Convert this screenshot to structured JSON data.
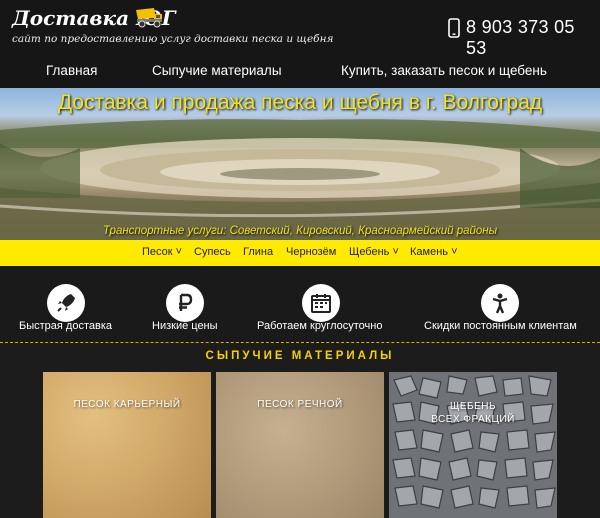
{
  "header": {
    "logo_title": "Доставка ЮГ",
    "logo_subtitle": "сайт по предоставлению услуг доставки песка и щебня",
    "phone": "8 903 373 05 53"
  },
  "nav": {
    "items": [
      "Главная",
      "Сыпучие материалы",
      "Купить, заказать песок и щебень"
    ]
  },
  "banner": {
    "title": "Доставка и продажа песка и щебня в г. Волгоград",
    "subtitle": "Транспортные услуги: Советский, Кировский, Красноармейский районы"
  },
  "categories": [
    "Песок",
    "Супесь",
    "Глина",
    "Чернозём",
    "Щебень",
    "Камень"
  ],
  "features": [
    {
      "label": "Быстрая доставка",
      "icon": "rocket-icon"
    },
    {
      "label": "Низкие цены",
      "icon": "ruble-icon"
    },
    {
      "label": "Работаем круглосуточно",
      "icon": "calendar-icon"
    },
    {
      "label": "Скидки постоянным клиентам",
      "icon": "person-icon"
    }
  ],
  "section": {
    "title": "СЫПУЧИЕ МАТЕРИАЛЫ"
  },
  "materials": [
    {
      "label": "ПЕСОК  КАРЬЕРНЫЙ",
      "color": "#d2aa6a"
    },
    {
      "label": "ПЕСОК  РЕЧНОЙ",
      "color": "#b39c7c"
    },
    {
      "label": "ЩЕБЕНЬ\nВСЕХ  ФРАКЦИЙ",
      "color": "#8a8d90"
    }
  ],
  "colors": {
    "accent": "#ffea00",
    "heading_yellow": "#f5e21a",
    "background": "#1c1c1c"
  }
}
